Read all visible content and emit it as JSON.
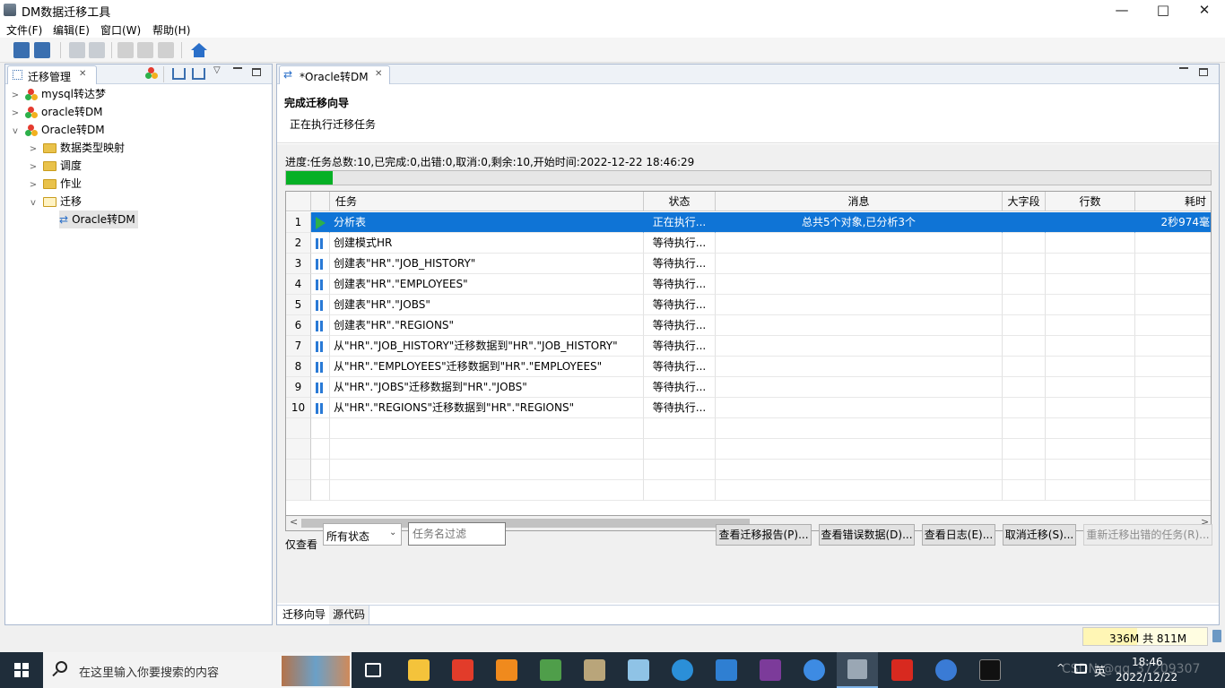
{
  "window": {
    "title": "DM数据迁移工具",
    "minimize": "—",
    "maximize": "□",
    "close": "✕"
  },
  "menu": {
    "file": "文件(F)",
    "edit": "编辑(E)",
    "window": "窗口(W)",
    "help": "帮助(H)"
  },
  "left": {
    "tab": "迁移管理",
    "close": "✕",
    "tree": [
      {
        "label": "mysql转达梦"
      },
      {
        "label": "oracle转DM"
      },
      {
        "label": "Oracle转DM"
      },
      {
        "label": "数据类型映射"
      },
      {
        "label": "调度"
      },
      {
        "label": "作业"
      },
      {
        "label": "迁移"
      },
      {
        "label": "Oracle转DM"
      }
    ]
  },
  "editor": {
    "tab": "*Oracle转DM",
    "close": "✕",
    "wizard_title": "完成迁移向导",
    "wizard_subtitle": "正在执行迁移任务",
    "progress_text": "进度:任务总数:10,已完成:0,出错:0,取消:0,剩余:10,开始时间:2022-12-22 18:46:29",
    "progress_fraction": 0.05,
    "columns": {
      "task": "任务",
      "status": "状态",
      "message": "消息",
      "bigfield": "大字段",
      "rows": "行数",
      "time": "耗时"
    },
    "rows": [
      {
        "n": "1",
        "task": "分析表",
        "status": "正在执行...",
        "message": "总共5个对象,已分析3个",
        "time": "2秒974毫"
      },
      {
        "n": "2",
        "task": "创建模式HR",
        "status": "等待执行...",
        "message": "",
        "time": ""
      },
      {
        "n": "3",
        "task": "创建表\"HR\".\"JOB_HISTORY\"",
        "status": "等待执行...",
        "message": "",
        "time": ""
      },
      {
        "n": "4",
        "task": "创建表\"HR\".\"EMPLOYEES\"",
        "status": "等待执行...",
        "message": "",
        "time": ""
      },
      {
        "n": "5",
        "task": "创建表\"HR\".\"JOBS\"",
        "status": "等待执行...",
        "message": "",
        "time": ""
      },
      {
        "n": "6",
        "task": "创建表\"HR\".\"REGIONS\"",
        "status": "等待执行...",
        "message": "",
        "time": ""
      },
      {
        "n": "7",
        "task": "从\"HR\".\"JOB_HISTORY\"迁移数据到\"HR\".\"JOB_HISTORY\"",
        "status": "等待执行...",
        "message": "",
        "time": ""
      },
      {
        "n": "8",
        "task": "从\"HR\".\"EMPLOYEES\"迁移数据到\"HR\".\"EMPLOYEES\"",
        "status": "等待执行...",
        "message": "",
        "time": ""
      },
      {
        "n": "9",
        "task": "从\"HR\".\"JOBS\"迁移数据到\"HR\".\"JOBS\"",
        "status": "等待执行...",
        "message": "",
        "time": ""
      },
      {
        "n": "10",
        "task": "从\"HR\".\"REGIONS\"迁移数据到\"HR\".\"REGIONS\"",
        "status": "等待执行...",
        "message": "",
        "time": ""
      }
    ],
    "filter_label": "仅查看",
    "filter_value": "所有状态",
    "filter_placeholder": "任务名过滤",
    "buttons": {
      "report": "查看迁移报告(P)...",
      "errors": "查看错误数据(D)...",
      "log": "查看日志(E)...",
      "cancel": "取消迁移(S)...",
      "retry": "重新迁移出错的任务(R)..."
    },
    "bottom_tabs": {
      "wizard": "迁移向导",
      "source": "源代码"
    }
  },
  "status": {
    "memory": "336M 共 811M"
  },
  "taskbar": {
    "search_placeholder": "在这里输入你要搜索的内容",
    "time": "18:46",
    "date": "2022/12/22",
    "ime": "英",
    "watermark": "CSDN @qq_37209307"
  }
}
